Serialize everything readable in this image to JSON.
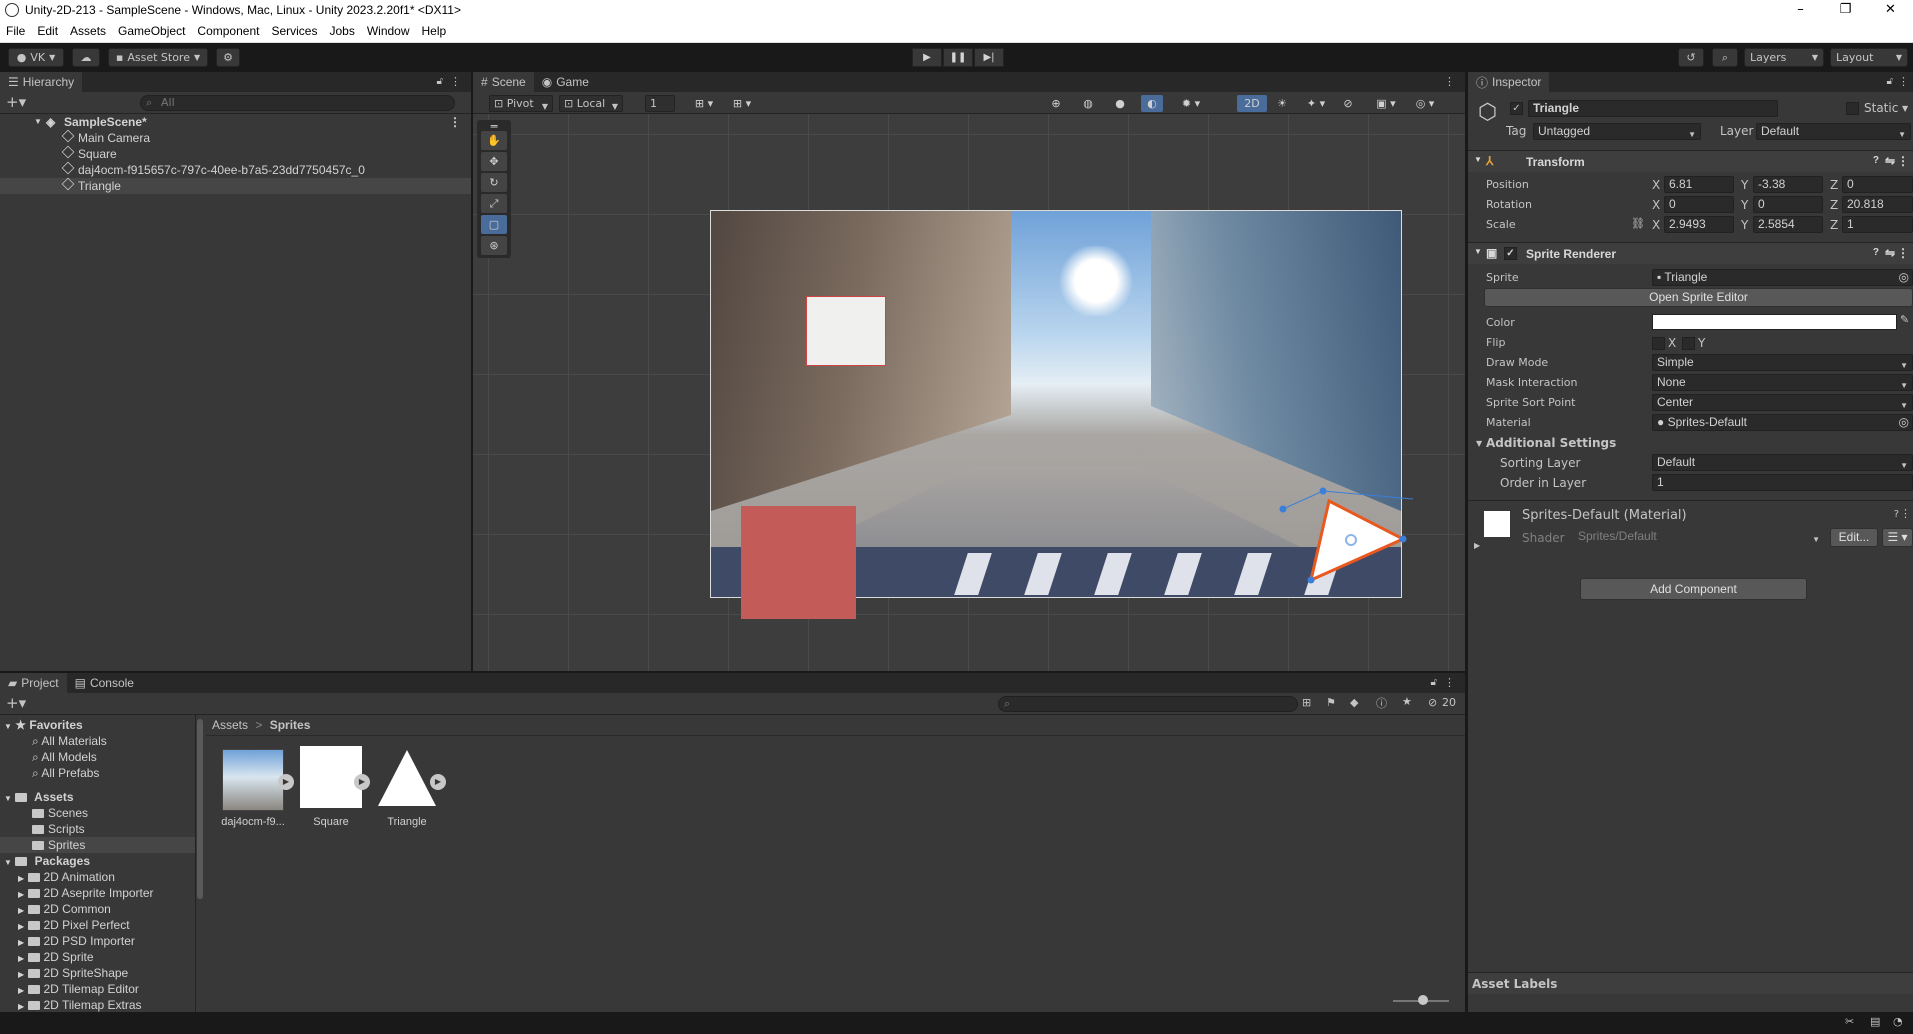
{
  "window": {
    "title": "Unity-2D-213 - SampleScene - Windows, Mac, Linux - Unity 2023.2.20f1* <DX11>",
    "controls": [
      "–",
      "❐",
      "✕"
    ]
  },
  "menu": [
    "File",
    "Edit",
    "Assets",
    "GameObject",
    "Component",
    "Services",
    "Jobs",
    "Window",
    "Help"
  ],
  "toolbar": {
    "account": "VK",
    "asset_store": "Asset Store",
    "layers": "Layers",
    "layout": "Layout"
  },
  "hierarchy": {
    "tab": "Hierarchy",
    "search_placeholder": "All",
    "scene": "SampleScene*",
    "items": [
      "Main Camera",
      "Square",
      "daj4ocm-f915657c-797c-40ee-b7a5-23dd7750457c_0",
      "Triangle"
    ],
    "selected": "Triangle"
  },
  "scene": {
    "tabs": [
      "Scene",
      "Game"
    ],
    "pivot": "Pivot",
    "local": "Local",
    "grid_snap": "1",
    "mode_2d": "2D"
  },
  "inspector": {
    "tab": "Inspector",
    "object_name": "Triangle",
    "static_label": "Static",
    "tag_label": "Tag",
    "tag_value": "Untagged",
    "layer_label": "Layer",
    "layer_value": "Default",
    "transform": {
      "title": "Transform",
      "position_label": "Position",
      "rotation_label": "Rotation",
      "scale_label": "Scale",
      "position": {
        "x": "6.81",
        "y": "-3.38",
        "z": "0"
      },
      "rotation": {
        "x": "0",
        "y": "0",
        "z": "20.818"
      },
      "scale": {
        "x": "2.9493",
        "y": "2.5854",
        "z": "1"
      }
    },
    "sprite_renderer": {
      "title": "Sprite Renderer",
      "sprite_label": "Sprite",
      "sprite_value": "Triangle",
      "open_editor": "Open Sprite Editor",
      "color_label": "Color",
      "flip_label": "Flip",
      "flip_x": "X",
      "flip_y": "Y",
      "draw_mode_label": "Draw Mode",
      "draw_mode_value": "Simple",
      "mask_label": "Mask Interaction",
      "mask_value": "None",
      "sort_point_label": "Sprite Sort Point",
      "sort_point_value": "Center",
      "material_label": "Material",
      "material_value": "Sprites-Default",
      "additional": "Additional Settings",
      "sorting_layer_label": "Sorting Layer",
      "sorting_layer_value": "Default",
      "order_label": "Order in Layer",
      "order_value": "1"
    },
    "material": {
      "title": "Sprites-Default (Material)",
      "shader_label": "Shader",
      "shader_value": "Sprites/Default",
      "edit": "Edit..."
    },
    "add_component": "Add Component",
    "asset_labels": "Asset Labels"
  },
  "project": {
    "tabs": [
      "Project",
      "Console"
    ],
    "hidden_count": "20",
    "favorites": "Favorites",
    "favorite_items": [
      "All Materials",
      "All Models",
      "All Prefabs"
    ],
    "assets": "Assets",
    "asset_folders": [
      "Scenes",
      "Scripts",
      "Sprites"
    ],
    "packages": "Packages",
    "package_folders": [
      "2D Animation",
      "2D Aseprite Importer",
      "2D Common",
      "2D Pixel Perfect",
      "2D PSD Importer",
      "2D Sprite",
      "2D SpriteShape",
      "2D Tilemap Editor",
      "2D Tilemap Extras"
    ],
    "breadcrumb": [
      "Assets",
      "Sprites"
    ],
    "files": [
      "daj4ocm-f9...",
      "Square",
      "Triangle"
    ]
  },
  "colors": {
    "accent_selection": "#4a6c9b",
    "triangle_outline": "#e8581f",
    "square_sprite": "#c35b59"
  }
}
